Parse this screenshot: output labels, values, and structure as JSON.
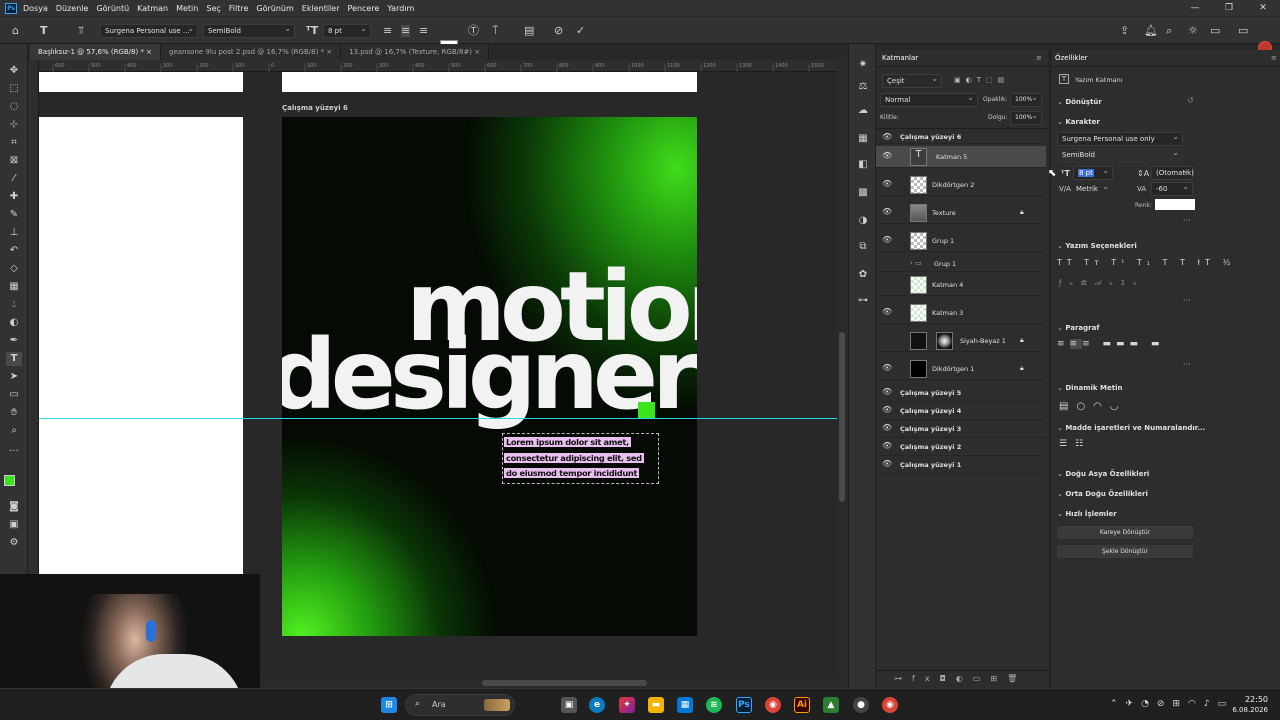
{
  "menu": [
    "Dosya",
    "Düzenle",
    "Görüntü",
    "Katman",
    "Metin",
    "Seç",
    "Filtre",
    "Görünüm",
    "Eklentiler",
    "Pencere",
    "Yardım"
  ],
  "options": {
    "font": "Surgena Personal use ...",
    "style": "SemiBold",
    "size": "8 pt"
  },
  "tabs": [
    "Başlıksız-1 @ 57,6% (RGB/8) *",
    "geansone 9lu post 2.psd @ 16,7% (RGB/8) *",
    "13.psd @ 16,7% (Texture, RGB/8#)"
  ],
  "tab_close": "×",
  "canvas": {
    "artboard_label": "Çalışma yüzeyi 6",
    "headline1": "motion",
    "headline2": "designer",
    "body": [
      "Lorem ipsum dolor sit amet,",
      "consectetur adipiscing elit, sed",
      "do eiusmod tempor incididunt"
    ],
    "accent": "#39e61d"
  },
  "ruler_ticks": [
    "600",
    "500",
    "400",
    "300",
    "200",
    "100",
    "0",
    "100",
    "200",
    "300",
    "400",
    "500",
    "600",
    "700",
    "800",
    "900",
    "1000",
    "1100",
    "1200",
    "1300",
    "1400",
    "1500"
  ],
  "layers": {
    "title": "Katmanlar",
    "search": "Çeşit",
    "blend": "Normal",
    "opacity_label": "Opaklık:",
    "opacity": "100%",
    "lock_label": "Kilitle:",
    "fill_label": "Dolgu:",
    "fill": "100%",
    "rows": [
      {
        "name": "Çalışma yüzeyi 6",
        "type": "group"
      },
      {
        "name": "Katman 5",
        "type": "text"
      },
      {
        "name": "Dikdörtgen 2",
        "type": "layer"
      },
      {
        "name": "Texture",
        "type": "layer"
      },
      {
        "name": "Grup 1",
        "type": "layer"
      },
      {
        "name": "Grup 1",
        "type": "folder"
      },
      {
        "name": "Katman 4",
        "type": "layer"
      },
      {
        "name": "Katman 3",
        "type": "layer"
      },
      {
        "name": "Siyah-Beyaz 1",
        "type": "adjust"
      },
      {
        "name": "Dikdörtgen 1",
        "type": "layer"
      },
      {
        "name": "Çalışma yüzeyi 5",
        "type": "group"
      },
      {
        "name": "Çalışma yüzeyi 4",
        "type": "group"
      },
      {
        "name": "Çalışma yüzeyi 3",
        "type": "group"
      },
      {
        "name": "Çalışma yüzeyi 2",
        "type": "group"
      },
      {
        "name": "Çalışma yüzeyi 1",
        "type": "group"
      }
    ]
  },
  "props": {
    "title": "Özellikler",
    "kind": "Yazım Katmanı",
    "transform": "Dönüştür",
    "character": "Karakter",
    "font": "Surgena Personal use only",
    "style": "SemiBold",
    "size": "8 pt",
    "leading": "(Otomatik)",
    "kerning": "Metrik",
    "tracking": "-60",
    "color_label": "Renk:",
    "type_options": "Yazım Seçenekleri",
    "paragraph": "Paragraf",
    "dynamic": "Dinamik Metin",
    "bullets": "Madde işaretleri ve Numaralandır...",
    "east_asian": "Doğu Asya Özellikleri",
    "middle_east": "Orta Doğu Özellikleri",
    "quick": "Hızlı İşlemler",
    "btn1": "Kareye Dönüştür",
    "btn2": "Şekle Dönüştür"
  },
  "taskbar": {
    "search": "Ara",
    "time": "22:50",
    "date": "6.08.2026"
  }
}
